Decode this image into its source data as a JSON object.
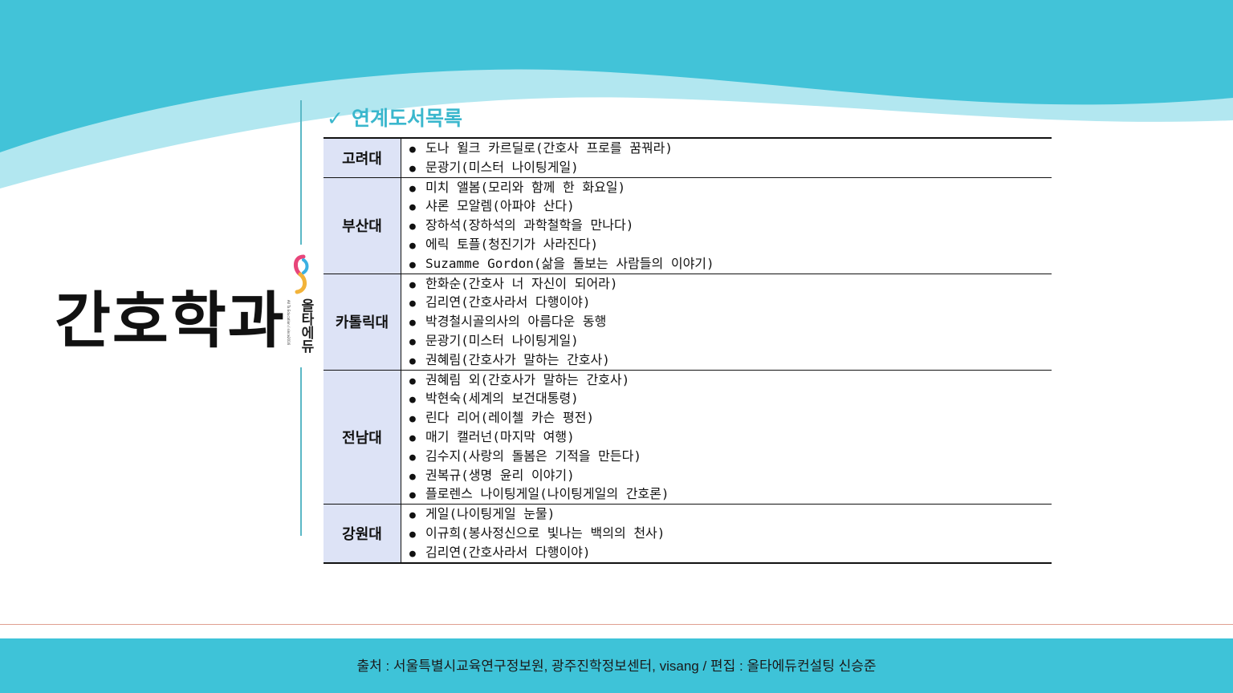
{
  "page_title": "간호학과",
  "logo": {
    "name": "올타에듀",
    "tagline": "All Ta Education / since2016"
  },
  "section": {
    "heading": "연계도서목록",
    "check_icon": "✓"
  },
  "bullet": "●",
  "book_table": [
    {
      "university": "고려대",
      "books": [
        "도나 윌크 카르딜로(간호사 프로를 꿈꿔라)",
        "문광기(미스터 나이팅게일)"
      ]
    },
    {
      "university": "부산대",
      "books": [
        "미치 앨봄(모리와 함께 한 화요일)",
        "샤론 모알렘(아파야 산다)",
        "장하석(장하석의 과학철학을 만나다)",
        "에릭 토플(청진기가 사라진다)",
        "Suzamme Gordon(삶을 돌보는 사람들의 이야기)"
      ]
    },
    {
      "university": "카톨릭대",
      "books": [
        "한화순(간호사 너 자신이 되어라)",
        "김리연(간호사라서 다행이야)",
        "박경철시골의사의 아름다운 동행",
        "문광기(미스터 나이팅게일)",
        "권혜림(간호사가 말하는 간호사)"
      ]
    },
    {
      "university": "전남대",
      "books": [
        "권혜림 외(간호사가 말하는 간호사)",
        "박현숙(세계의 보건대통령)",
        "린다 리어(레이첼 카슨 평전)",
        "매기 캘러넌(마지막 여행)",
        "김수지(사랑의 돌봄은 기적을 만든다)",
        "권복규(생명 윤리 이야기)",
        "플로렌스 나이팅게일(나이팅게일의 간호론)"
      ]
    },
    {
      "university": "강원대",
      "books": [
        "게일(나이팅게일 눈물)",
        "이규희(봉사정신으로 빛나는 백의의 천사)",
        "김리연(간호사라서 다행이야)"
      ]
    }
  ],
  "footer": {
    "source": "출처 : 서울특별시교육연구정보원, 광주진학정보센터, visang  /  편집 : 올타에듀컨설팅 신승준"
  },
  "colors": {
    "accent": "#3bb7cd",
    "header_band": "#42c3d8",
    "univ_cell": "#dde3f6"
  }
}
